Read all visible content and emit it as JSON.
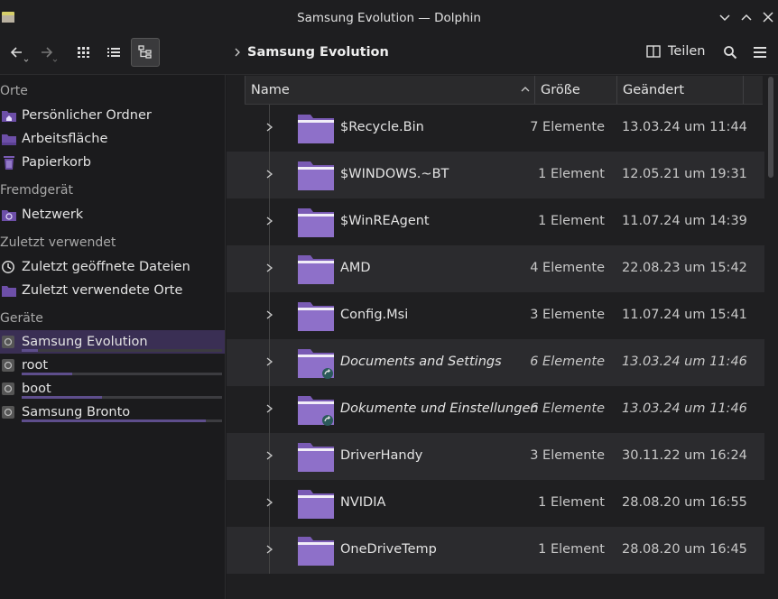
{
  "window": {
    "title": "Samsung Evolution — Dolphin"
  },
  "toolbar": {
    "breadcrumb": "Samsung Evolution",
    "share_label": "Teilen"
  },
  "sidebar": {
    "sections": {
      "orte": "Orte",
      "fremdgeraet": "Fremdgerät",
      "zuletzt": "Zuletzt verwendet",
      "geraete": "Geräte"
    },
    "places": [
      "Persönlicher Ordner",
      "Arbeitsfläche",
      "Papierkorb"
    ],
    "remote": [
      "Netzwerk"
    ],
    "recent": [
      "Zuletzt geöffnete Dateien",
      "Zuletzt verwendete Orte"
    ],
    "devices": [
      {
        "label": "Samsung Evolution",
        "usage": 0.08
      },
      {
        "label": "root",
        "usage": 0.25
      },
      {
        "label": "boot",
        "usage": 0.4
      },
      {
        "label": "Samsung Bronto",
        "usage": 0.92
      }
    ]
  },
  "columns": {
    "name": "Name",
    "size": "Größe",
    "modified": "Geändert"
  },
  "files": [
    {
      "name": "$Recycle.Bin",
      "size": "7 Elemente",
      "date": "13.03.24 um 11:44",
      "link": false
    },
    {
      "name": "$WINDOWS.~BT",
      "size": "1 Element",
      "date": "12.05.21 um 19:31",
      "link": false
    },
    {
      "name": "$WinREAgent",
      "size": "1 Element",
      "date": "11.07.24 um 14:39",
      "link": false
    },
    {
      "name": "AMD",
      "size": "4 Elemente",
      "date": "22.08.23 um 15:42",
      "link": false
    },
    {
      "name": "Config.Msi",
      "size": "3 Elemente",
      "date": "11.07.24 um 15:41",
      "link": false
    },
    {
      "name": "Documents and Settings",
      "size": "6 Elemente",
      "date": "13.03.24 um 11:46",
      "link": true
    },
    {
      "name": "Dokumente und Einstellungen",
      "size": "6 Elemente",
      "date": "13.03.24 um 11:46",
      "link": true
    },
    {
      "name": "DriverHandy",
      "size": "3 Elemente",
      "date": "30.11.22 um 16:24",
      "link": false
    },
    {
      "name": "NVIDIA",
      "size": "1 Element",
      "date": "28.08.20 um 16:55",
      "link": false
    },
    {
      "name": "OneDriveTemp",
      "size": "1 Element",
      "date": "28.08.20 um 16:45",
      "link": false
    }
  ],
  "colors": {
    "accent": "#3a2f54",
    "folder": "#7a5bb5",
    "folder_tab": "#8e70c9"
  }
}
